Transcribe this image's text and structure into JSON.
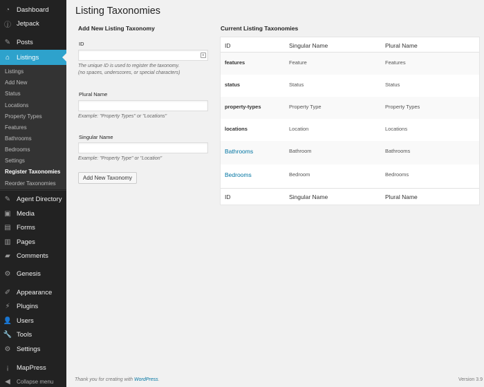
{
  "sidebar": {
    "top_items": [
      {
        "label": "Dashboard",
        "icon": "dashboard-icon",
        "glyph": "◔"
      },
      {
        "label": "Jetpack",
        "icon": "jetpack-icon",
        "glyph": "ⓙ"
      },
      {
        "label": "Posts",
        "icon": "pin-icon",
        "glyph": "✎"
      },
      {
        "label": "Listings",
        "icon": "home-icon",
        "glyph": "⌂"
      }
    ],
    "submenu": [
      "Listings",
      "Add New",
      "Status",
      "Locations",
      "Property Types",
      "Features",
      "Bathrooms",
      "Bedrooms",
      "Settings",
      "Register Taxonomies",
      "Reorder Taxonomies"
    ],
    "current_submenu": "Register Taxonomies",
    "bottom_items": [
      {
        "label": "Agent Directory",
        "icon": "pin-icon",
        "glyph": "✎"
      },
      {
        "label": "Media",
        "icon": "media-icon",
        "glyph": "▣"
      },
      {
        "label": "Forms",
        "icon": "forms-icon",
        "glyph": "▤"
      },
      {
        "label": "Pages",
        "icon": "pages-icon",
        "glyph": "▥"
      },
      {
        "label": "Comments",
        "icon": "comments-icon",
        "glyph": "▰"
      },
      {
        "label": "Genesis",
        "icon": "genesis-icon",
        "glyph": "⚙"
      },
      {
        "label": "Appearance",
        "icon": "appearance-icon",
        "glyph": "✐"
      },
      {
        "label": "Plugins",
        "icon": "plugins-icon",
        "glyph": "⚡"
      },
      {
        "label": "Users",
        "icon": "users-icon",
        "glyph": "👤"
      },
      {
        "label": "Tools",
        "icon": "tools-icon",
        "glyph": "🔧"
      },
      {
        "label": "Settings",
        "icon": "settings-icon",
        "glyph": "⚙"
      },
      {
        "label": "MapPress",
        "icon": "mappress-icon",
        "glyph": "¡"
      },
      {
        "label": "Collapse menu",
        "icon": "collapse-icon",
        "glyph": "◀"
      }
    ]
  },
  "page": {
    "title": "Listing Taxonomies"
  },
  "form": {
    "heading": "Add New Listing Taxonomy",
    "id_label": "ID",
    "id_value": "",
    "id_help_1": "The unique ID is used to register the taxonomy.",
    "id_help_2": "(no spaces, underscores, or special characters)",
    "plural_label": "Plural Name",
    "plural_value": "",
    "plural_help": "Example: \"Property Types\" or \"Locations\"",
    "singular_label": "Singular Name",
    "singular_value": "",
    "singular_help": "Example: \"Property Type\" or \"Location\"",
    "submit_label": "Add New Taxonomy"
  },
  "table": {
    "heading": "Current Listing Taxonomies",
    "columns": [
      "ID",
      "Singular Name",
      "Plural Name"
    ],
    "rows": [
      {
        "id": "features",
        "singular": "Feature",
        "plural": "Features",
        "link": false
      },
      {
        "id": "status",
        "singular": "Status",
        "plural": "Status",
        "link": false
      },
      {
        "id": "property-types",
        "singular": "Property Type",
        "plural": "Property Types",
        "link": false
      },
      {
        "id": "locations",
        "singular": "Location",
        "plural": "Locations",
        "link": false
      },
      {
        "id": "Bathrooms",
        "singular": "Bathroom",
        "plural": "Bathrooms",
        "link": true
      },
      {
        "id": "Bedrooms",
        "singular": "Bedroom",
        "plural": "Bedrooms",
        "link": true
      }
    ]
  },
  "footer": {
    "thanks_prefix": "Thank you for creating with",
    "thanks_link": "WordPress",
    "thanks_suffix": ".",
    "version": "Version 3.9"
  },
  "colors": {
    "sidebar_bg": "#222222",
    "submenu_bg": "#333333",
    "accent": "#2ea2cc",
    "link": "#0074a2"
  }
}
